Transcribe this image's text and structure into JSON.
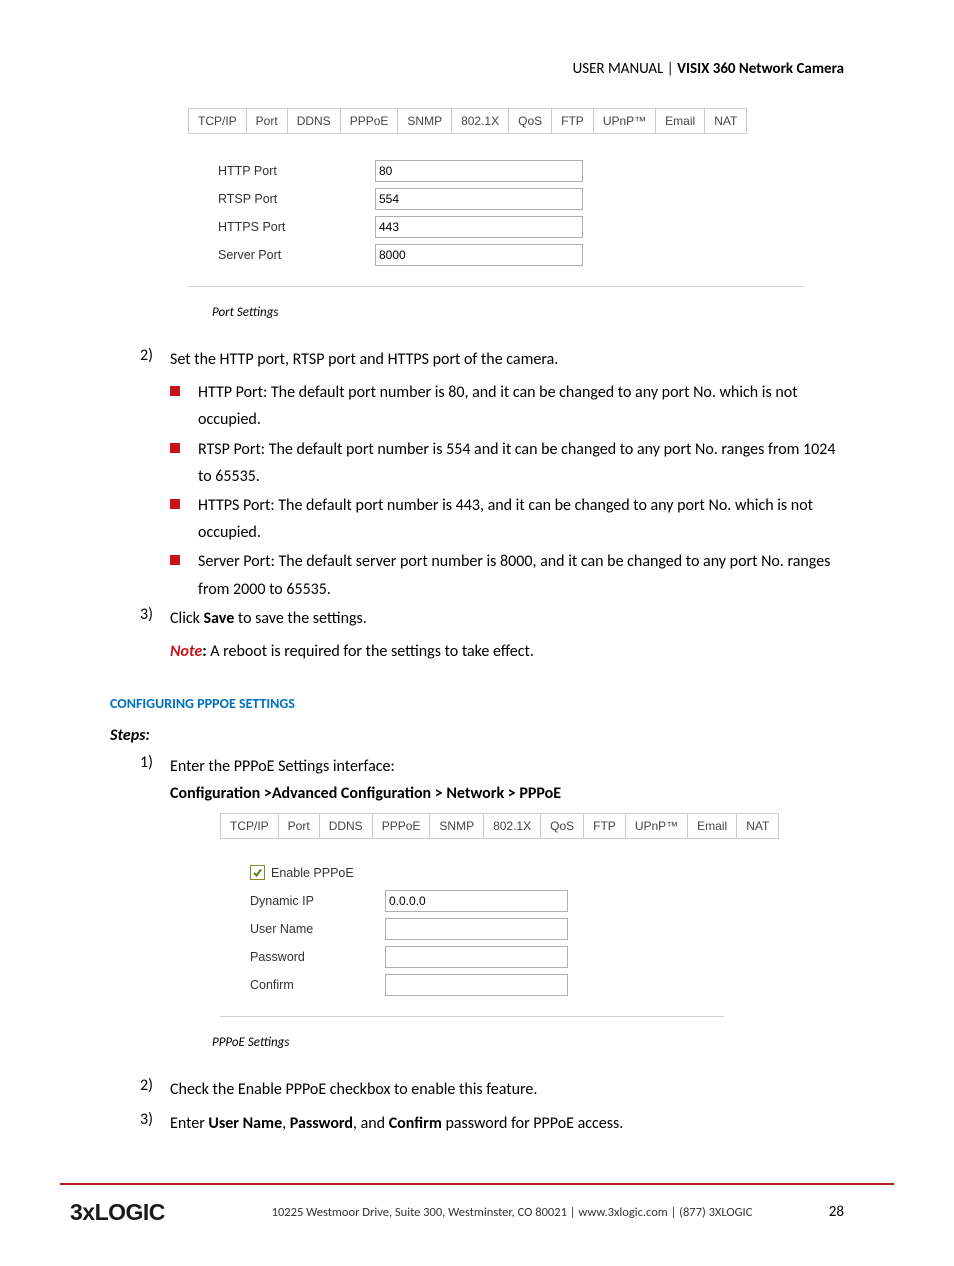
{
  "header": {
    "prefix": "USER MANUAL | ",
    "title": "VISIX 360 Network Camera"
  },
  "tabs": [
    "TCP/IP",
    "Port",
    "DDNS",
    "PPPoE",
    "SNMP",
    "802.1X",
    "QoS",
    "FTP",
    "UPnP™",
    "Email",
    "NAT"
  ],
  "port_panel": {
    "fields": [
      {
        "label": "HTTP Port",
        "value": "80"
      },
      {
        "label": "RTSP Port",
        "value": "554"
      },
      {
        "label": "HTTPS Port",
        "value": "443"
      },
      {
        "label": "Server Port",
        "value": "8000"
      }
    ]
  },
  "caption1": "Port Settings",
  "steps_a": {
    "s2": "Set the HTTP port, RTSP port and HTTPS port of the camera.",
    "bullets": [
      "HTTP Port: The default port number is 80, and it can be changed to any port No. which is not occupied.",
      "RTSP Port: The default port number is 554 and it can be changed to any port No. ranges from 1024 to 65535.",
      "HTTPS Port: The default port number is 443, and it can be changed to any port No. which is not occupied.",
      "Server Port: The default server port number is 8000, and it can be changed to any port No. ranges from 2000 to 65535."
    ],
    "s3a": "Click ",
    "s3b": "Save",
    "s3c": " to save the settings.",
    "note_label": "Note",
    "note_body": " A reboot is required for the settings to take effect."
  },
  "section2": "CONFIGURING PPPOE SETTINGS",
  "steps_label": "Steps:",
  "steps_b": {
    "s1": "Enter the PPPoE Settings interface:",
    "s1_path": "Configuration >Advanced Configuration > Network > PPPoE",
    "s2": "Check the Enable PPPoE checkbox to enable this feature.",
    "s3_parts": [
      "Enter ",
      "User Name",
      ", ",
      "Password",
      ", and ",
      "Confirm",
      " password for PPPoE access."
    ]
  },
  "pppoe_panel": {
    "checkbox_label": "Enable PPPoE",
    "checkbox_checked": true,
    "fields": [
      {
        "label": "Dynamic IP",
        "value": "0.0.0.0"
      },
      {
        "label": "User Name",
        "value": ""
      },
      {
        "label": "Password",
        "value": ""
      },
      {
        "label": "Confirm",
        "value": ""
      }
    ]
  },
  "caption2": "PPPoE Settings",
  "footer": {
    "logo": "3xLOGIC",
    "address": "10225 Westmoor Drive, Suite 300, Westminster, CO 80021 | www.3xlogic.com | (877) 3XLOGIC",
    "page": "28"
  }
}
